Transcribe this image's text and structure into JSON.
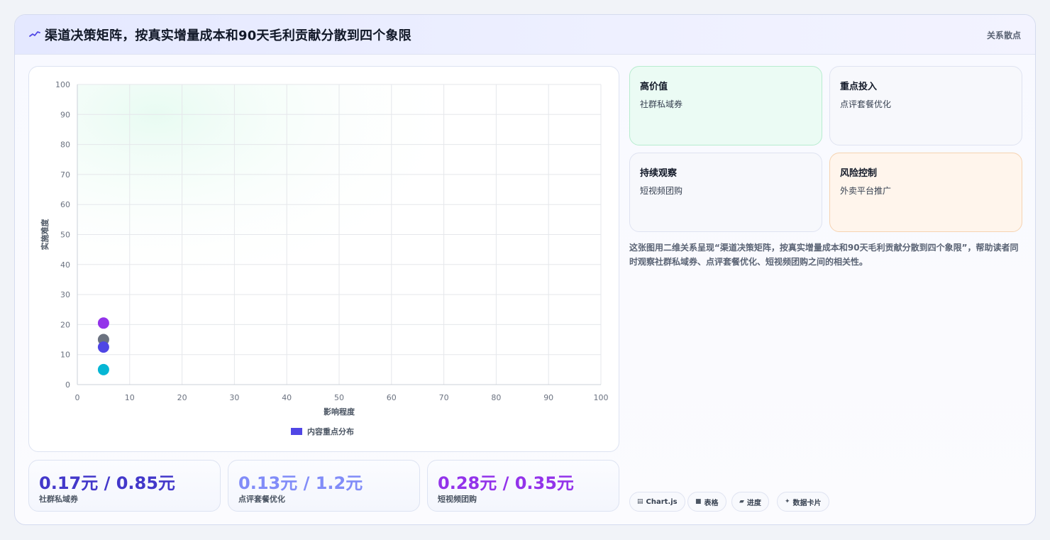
{
  "header": {
    "title": "渠道决策矩阵，按真实增量成本和90天毛利贡献分散到四个象限",
    "tag": "关系散点"
  },
  "chart_data": {
    "type": "scatter",
    "xlabel": "影响程度",
    "ylabel": "实施难度",
    "xlim": [
      0,
      100
    ],
    "ylim": [
      0,
      100
    ],
    "x_ticks": [
      0,
      10,
      20,
      30,
      40,
      50,
      60,
      70,
      80,
      90,
      100
    ],
    "y_ticks": [
      0,
      10,
      20,
      30,
      40,
      50,
      60,
      70,
      80,
      90,
      100
    ],
    "grid": true,
    "legend": {
      "position": "bottom",
      "label": "内容重点分布",
      "color": "#5046e5"
    },
    "points": [
      {
        "x": 5,
        "y": 20.5,
        "color": "#9333ea"
      },
      {
        "x": 5,
        "y": 15,
        "color": "#6b7280"
      },
      {
        "x": 5,
        "y": 12.5,
        "color": "#4f46e5"
      },
      {
        "x": 5,
        "y": 5,
        "color": "#06b6d4"
      }
    ]
  },
  "metrics": [
    {
      "value": "0.17元 / 0.85元",
      "label": "社群私域券",
      "color": "#4338ca"
    },
    {
      "value": "0.13元 / 1.2元",
      "label": "点评套餐优化",
      "color": "#818cf8"
    },
    {
      "value": "0.28元 / 0.35元",
      "label": "短视频团购",
      "color": "#9333ea"
    }
  ],
  "quadrants": [
    {
      "title": "高价值",
      "item": "社群私域券",
      "bg": "#ebfbf4",
      "border": "#b7eccf"
    },
    {
      "title": "重点投入",
      "item": "点评套餐优化",
      "bg": "#f7f8fc",
      "border": "#dfe3f1"
    },
    {
      "title": "持续观察",
      "item": "短视频团购",
      "bg": "#f7f8fc",
      "border": "#dfe3f1"
    },
    {
      "title": "风险控制",
      "item": "外卖平台推广",
      "bg": "#fff5ec",
      "border": "#f6d3b1"
    }
  ],
  "description": "这张图用二维关系呈现“渠道决策矩阵，按真实增量成本和90天毛利贡献分散到四个象限”，帮助读者同时观察社群私域券、点评套餐优化、短视频团购之间的相关性。",
  "tags": [
    {
      "icon": "chart-icon",
      "glyph": "▤",
      "label": "Chart.js"
    },
    {
      "icon": "table-icon",
      "glyph": "■",
      "label": "表格"
    },
    {
      "icon": "progress-icon",
      "glyph": "▰",
      "label": "进度"
    },
    {
      "icon": "data-card-icon",
      "glyph": "✦",
      "label": "数据卡片"
    }
  ]
}
